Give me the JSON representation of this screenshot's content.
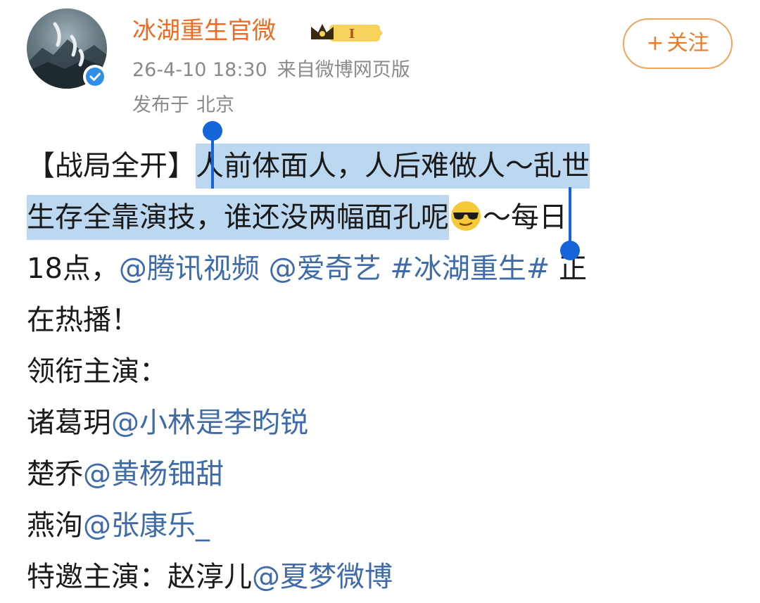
{
  "post_header": {
    "account_name": "冰湖重生官微",
    "vip_level": "I",
    "date": "26-4-10 18:30",
    "source": "来自微博网页版",
    "location_label": "发布于",
    "location": "北京",
    "follow_label": "关注",
    "follow_plus": "+"
  },
  "post_body": {
    "line1": {
      "tag": "【战局全开】",
      "selected": "人前体面人，人后难做人～乱世"
    },
    "line2": {
      "selected": "生存全靠演技，谁还没两幅面孔呢",
      "emoji_name": "sunglasses-emoji",
      "after": "～每日"
    },
    "line3": {
      "text": "18点，",
      "mention1": "@腾讯视频",
      "mention2": "@爱奇艺",
      "hashtag": "#冰湖重生#",
      "after": "正"
    },
    "line4": {
      "text": "在热播！"
    },
    "line5": {
      "text": "领衔主演："
    },
    "line6": {
      "role": "诸葛玥",
      "mention": "@小林是李昀锐"
    },
    "line7": {
      "role": "楚乔",
      "mention": "@黄杨钿甜"
    },
    "line8": {
      "role": "燕洵",
      "mention": "@张康乐_"
    },
    "line9": {
      "text": "特邀主演：赵淳儿",
      "mention": "@夏梦微博"
    }
  },
  "colors": {
    "account_name": "#f06b1f",
    "link": "#3f6ba9",
    "meta": "#8a8a8a",
    "selection": "#bcd7f0",
    "selection_handle": "#1565d8",
    "follow_border": "#f0a55c"
  }
}
